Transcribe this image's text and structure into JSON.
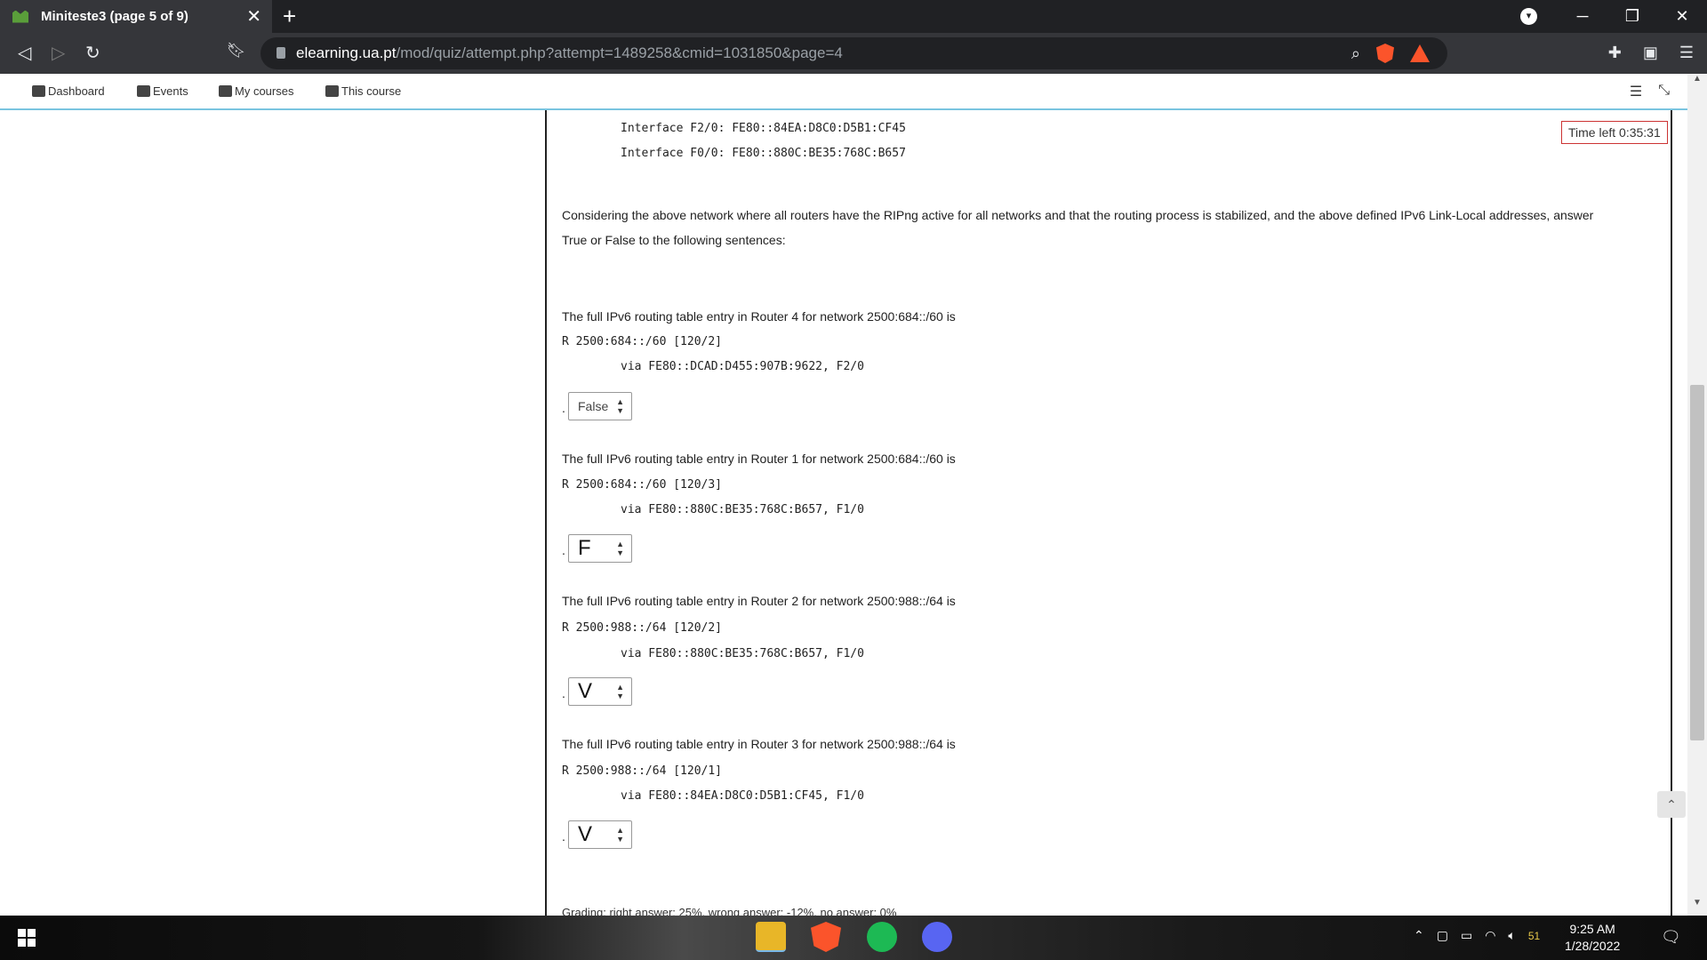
{
  "browser": {
    "tab_title": "Miniteste3 (page 5 of 9)",
    "tab_close": "✕",
    "new_tab": "+",
    "url_host": "elearning.ua.pt",
    "url_path": "/mod/quiz/attempt.php?attempt=1489258&cmid=1031850&page=4",
    "brave_badge": "1"
  },
  "moodle_nav": {
    "items": [
      {
        "label": "Dashboard"
      },
      {
        "label": "Events"
      },
      {
        "label": "My courses"
      },
      {
        "label": "This course"
      }
    ]
  },
  "timer": {
    "text": "Time left 0:35:31"
  },
  "question": {
    "interfaces": [
      "Interface F2/0: FE80::84EA:D8C0:D5B1:CF45",
      "Interface F0/0: FE80::880C:BE35:768C:B657"
    ],
    "intro_line1": "Considering the above network where all routers have the RIPng active for all networks and that the routing process is stabilized, and the above defined IPv6 Link-Local addresses, answer",
    "intro_line2": "True or False to the following sentences:",
    "items": [
      {
        "statement": "The full IPv6 routing table entry in Router 4 for network 2500:684::/60 is",
        "route": "R 2500:684::/60 [120/2]",
        "via": "via FE80::DCAD:D455:907B:9622, F2/0",
        "answer": "False"
      },
      {
        "statement": "The full IPv6 routing table entry in Router 1 for network 2500:684::/60 is",
        "route": "R 2500:684::/60 [120/3]",
        "via": "via FE80::880C:BE35:768C:B657, F1/0",
        "answer": "F"
      },
      {
        "statement": "The full IPv6 routing table entry in Router 2 for network 2500:988::/64 is",
        "route": "R 2500:988::/64 [120/2]",
        "via": "via FE80::880C:BE35:768C:B657, F1/0",
        "answer": "V"
      },
      {
        "statement": "The full IPv6 routing table entry in Router 3 for network 2500:988::/64 is",
        "route": "R 2500:988::/64 [120/1]",
        "via": "via FE80::84EA:D8C0:D5B1:CF45, F1/0",
        "answer": "V"
      }
    ],
    "grading": "Grading: right answer: 25%, wrong answer: -12%, no answer: 0%"
  },
  "taskbar": {
    "time": "9:25 AM",
    "date": "1/28/2022",
    "tray_number": "51"
  }
}
